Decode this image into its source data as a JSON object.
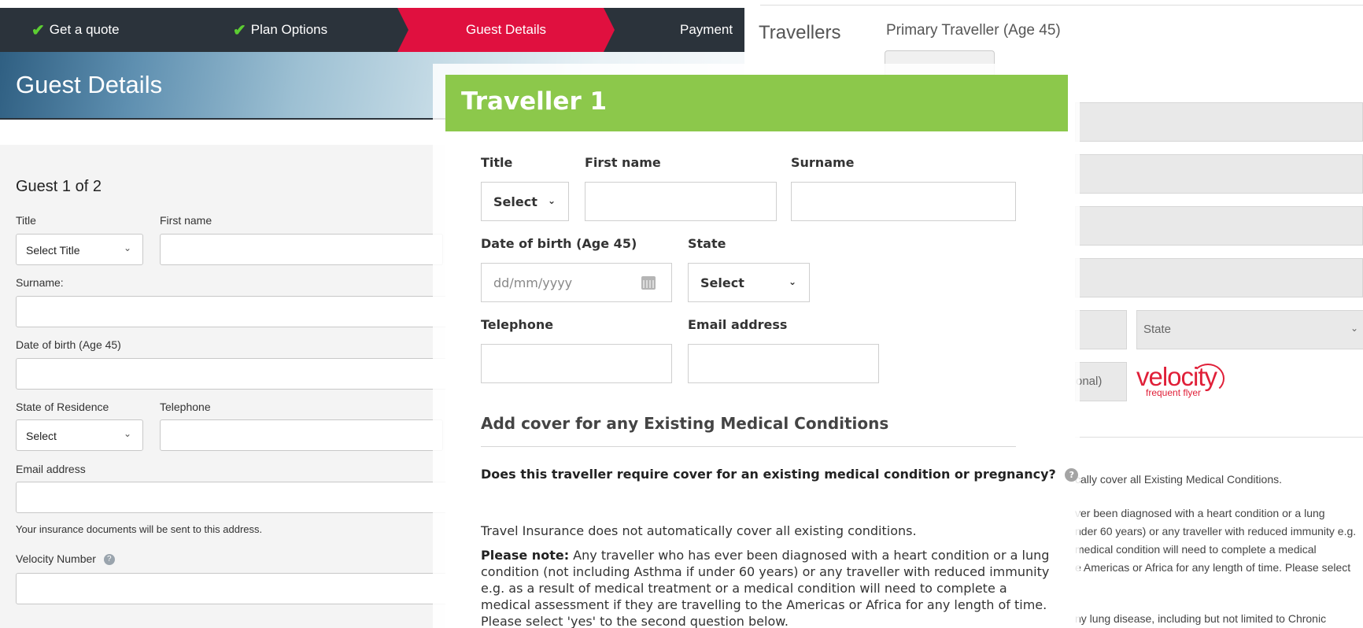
{
  "stepper": {
    "steps": [
      {
        "label": "Get a quote",
        "done": true
      },
      {
        "label": "Plan Options",
        "done": true
      },
      {
        "label": "Guest Details",
        "active": true
      },
      {
        "label": "Payment"
      }
    ],
    "check_glyph": "✔"
  },
  "left": {
    "page_title": "Guest Details",
    "guest_heading": "Guest 1 of 2",
    "title_label": "Title",
    "title_select": "Select Title",
    "first_name_label": "First name",
    "surname_label": "Surname:",
    "dob_label": "Date of birth (Age 45)",
    "state_label": "State of Residence",
    "state_select": "Select",
    "telephone_label": "Telephone",
    "email_label": "Email address",
    "email_note": "Your insurance documents will be sent to this address.",
    "velocity_label": "Velocity Number",
    "help_glyph": "?"
  },
  "right": {
    "travellers_heading": "Travellers",
    "primary_heading": "Primary Traveller (Age 45)",
    "state_select": "State",
    "optional_fragment": "onal)",
    "velocity_logo_word": "velocity",
    "velocity_logo_sub": "frequent flyer",
    "text_1": "cally cover all Existing Medical Conditions.",
    "text_2": "ver been diagnosed with a heart condition or a lung",
    "text_3": "nder 60 years) or any traveller with reduced immunity e.g.",
    "text_4": "medical condition will need to complete a medical",
    "text_5": "e Americas or Africa for any length of time. Please select",
    "text_6": "ny lung disease, including but not limited to Chronic"
  },
  "modal": {
    "title": "Traveller 1",
    "title_label": "Title",
    "title_select": "Select",
    "first_name_label": "First name",
    "surname_label": "Surname",
    "dob_label": "Date of birth (Age 45)",
    "dob_placeholder": "dd/mm/yyyy",
    "state_label": "State",
    "state_select": "Select",
    "telephone_label": "Telephone",
    "email_label": "Email address",
    "section_heading": "Add cover for any Existing Medical Conditions",
    "question": "Does this traveller require cover for an existing medical condition or pregnancy?",
    "help_glyph": "?",
    "info_text": "Travel Insurance does not automatically cover all existing conditions.",
    "note_label": "Please note:",
    "note_line_1": " Any traveller who has ever been diagnosed with a heart condition or a lung",
    "note_line_2": "condition (not including Asthma if under 60 years) or any traveller with reduced immunity",
    "note_line_3": "e.g. as a result of medical treatment or a medical condition will need to complete a",
    "note_line_4": "medical assessment if they are travelling to the Americas or Africa for any length of time.",
    "note_line_5": "Please select 'yes' to the second question below."
  },
  "colors": {
    "stepper_bg": "#2b333b",
    "active_step": "#e0103f",
    "check": "#5ccd32",
    "modal_header": "#8cc84b",
    "velocity_red": "#e01f38"
  },
  "icons": {
    "check": "check-icon",
    "chevron": "chevron-down-icon",
    "calendar": "calendar-icon",
    "help": "help-icon"
  }
}
